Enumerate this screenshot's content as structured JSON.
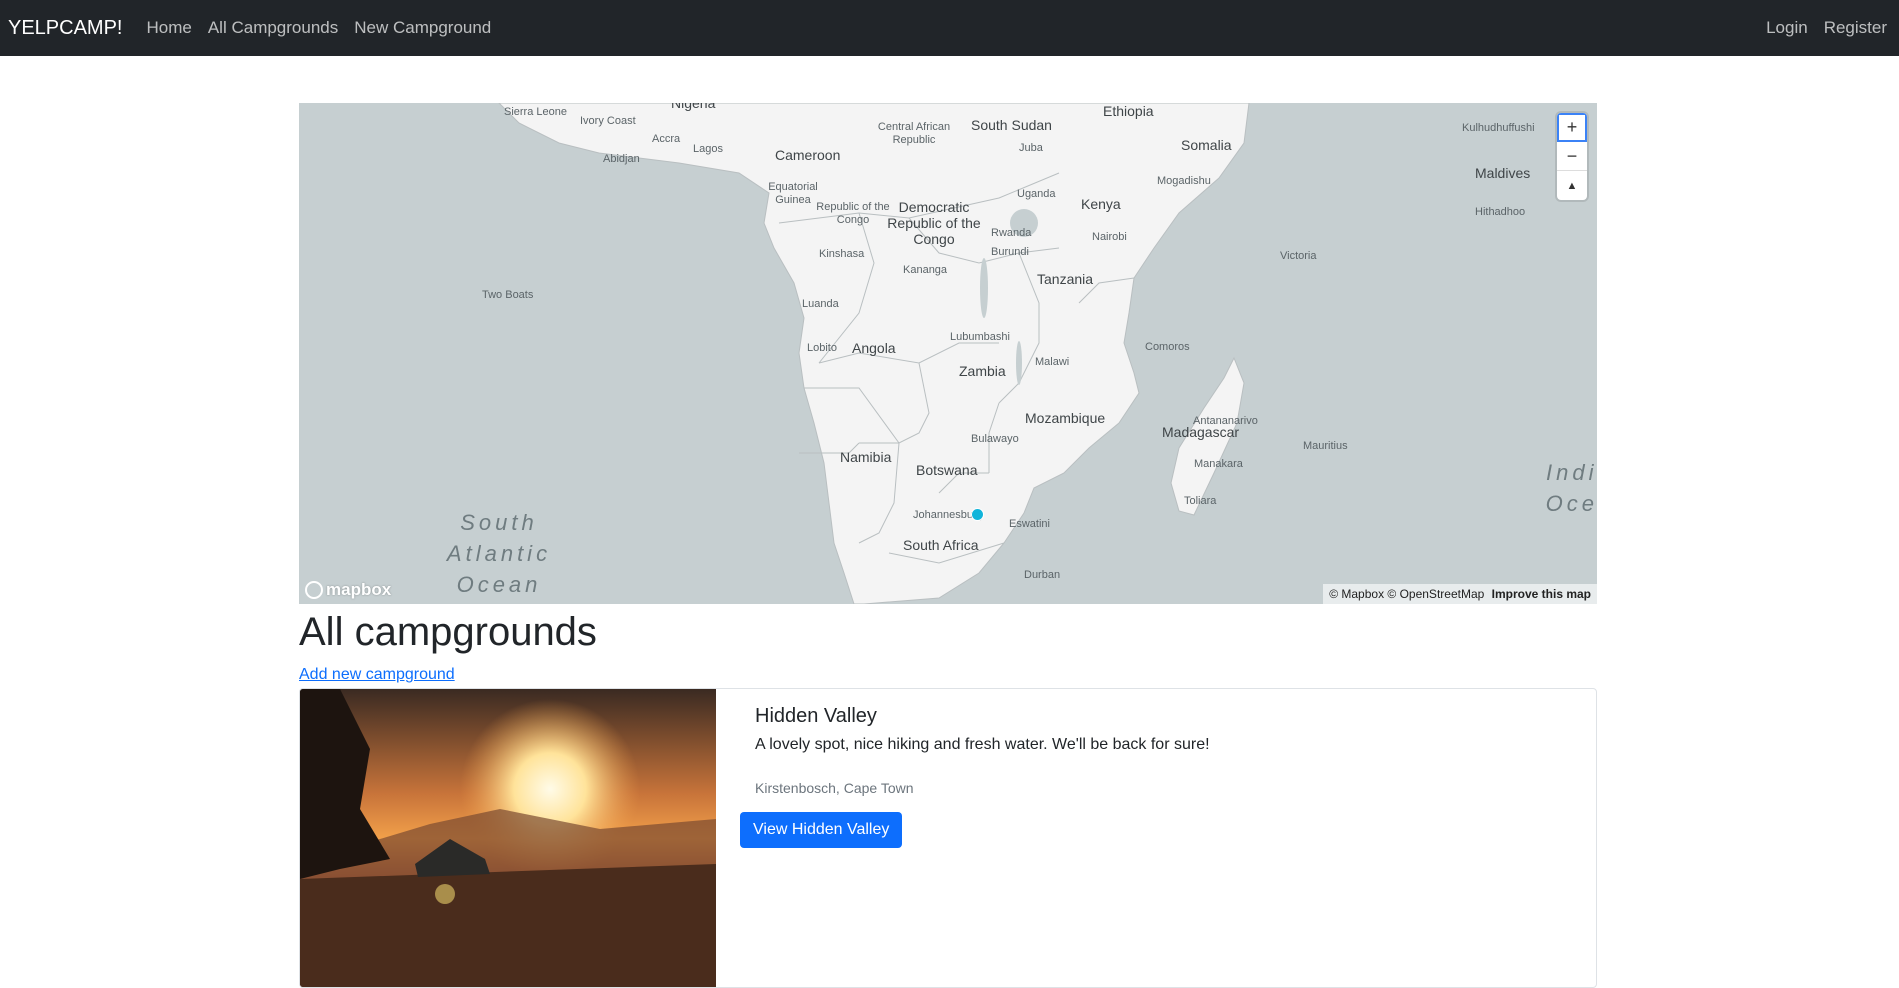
{
  "navbar": {
    "brand": "YELPCAMP!",
    "links": [
      "Home",
      "All Campgrounds",
      "New Campground"
    ],
    "auth": [
      "Login",
      "Register"
    ]
  },
  "map": {
    "ocean_color": "#c6cfd1",
    "land_color": "#f4f4f4",
    "marker_color": "#11b4da",
    "countries": [
      "Nigeria",
      "Ethiopia",
      "South Sudan",
      "Central African Republic",
      "Cameroon",
      "Somalia",
      "Equatorial Guinea",
      "Republic of the Congo",
      "Democratic Republic of the Congo",
      "Uganda",
      "Kenya",
      "Rwanda",
      "Burundi",
      "Tanzania",
      "Angola",
      "Zambia",
      "Malawi",
      "Mozambique",
      "Madagascar",
      "Namibia",
      "Botswana",
      "South Africa",
      "Eswatini",
      "Comoros",
      "Maldives",
      "Sierra Leone",
      "Ivory Coast"
    ],
    "cities": [
      "Abidjan",
      "Accra",
      "Lagos",
      "Juba",
      "Mogadishu",
      "Nairobi",
      "Kinshasa",
      "Kananga",
      "Luanda",
      "Lobito",
      "Lubumbashi",
      "Bulawayo",
      "Johannesburg",
      "Durban",
      "Antananarivo",
      "Toliara",
      "Manakara",
      "Mauritius",
      "Victoria",
      "Two Boats",
      "Kulhudhuffushi",
      "Hithadhoo"
    ],
    "oceans": [
      "South Atlantic Ocean",
      "Indian Ocean"
    ],
    "controls": {
      "zoom_in": "+",
      "zoom_out": "−",
      "compass": "▲"
    },
    "attribution": "© Mapbox © OpenStreetMap",
    "improve": "Improve this map",
    "logo": "mapbox"
  },
  "main": {
    "heading": "All campgrounds",
    "add_link": "Add new campground"
  },
  "campgrounds": [
    {
      "title": "Hidden Valley",
      "description": "A lovely spot, nice hiking and fresh water. We'll be back for sure!",
      "location": "Kirstenbosch, Cape Town",
      "button": "View Hidden Valley"
    }
  ]
}
